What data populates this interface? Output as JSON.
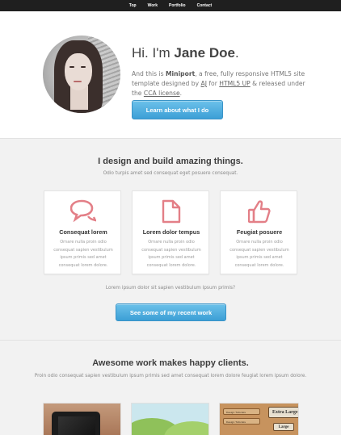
{
  "nav": {
    "items": [
      "Top",
      "Work",
      "Portfolio",
      "Contact"
    ]
  },
  "hero": {
    "greeting": "Hi. I'm ",
    "name": "Jane Doe",
    "period": ".",
    "intro_prefix": "And this is ",
    "intro_brand": "Miniport",
    "intro_mid1": ", a free, fully responsive HTML5 site template designed by ",
    "intro_link1": "AJ",
    "intro_mid2": " for ",
    "intro_link2": "HTML5 UP",
    "intro_mid3": " & released under the ",
    "intro_link3": "CCA license",
    "intro_end": ".",
    "button": "Learn about what I do"
  },
  "features": {
    "title": "I design and build amazing things.",
    "subtitle": "Odio turpis amet sed consequat eget posuere consequat.",
    "cards": [
      {
        "icon": "speech-bubbles-icon",
        "title": "Consequat lorem",
        "text": "Ornare nulla proin odio consequat sapien vestibulum ipsum primis sed amet consequat lorem dolore."
      },
      {
        "icon": "document-icon",
        "title": "Lorem dolor tempus",
        "text": "Ornare nulla proin odio consequat sapien vestibulum ipsum primis sed amet consequat lorem dolore."
      },
      {
        "icon": "thumbs-up-icon",
        "title": "Feugiat posuere",
        "text": "Ornare nulla proin odio consequat sapien vestibulum ipsum primis sed amet consequat lorem dolore."
      }
    ],
    "note": "Lorem ipsum dolor sit sapien vestibulum ipsum primis?",
    "button": "See some of my recent work"
  },
  "work": {
    "title": "Awesome work makes happy clients.",
    "subtitle": "Proin odio consequat sapien vestibulum ipsum primis sed amet consequat lorem dolore feugiat lorem ipsum dolore.",
    "thumb3": {
      "row1": "Design Tutorials",
      "row2": "Design Tutorials",
      "big": "Extra Large",
      "small": "Large"
    }
  },
  "colors": {
    "accent": "#45a7dc",
    "icon": "#e37f87",
    "nav_bg": "#1f1f1f"
  }
}
